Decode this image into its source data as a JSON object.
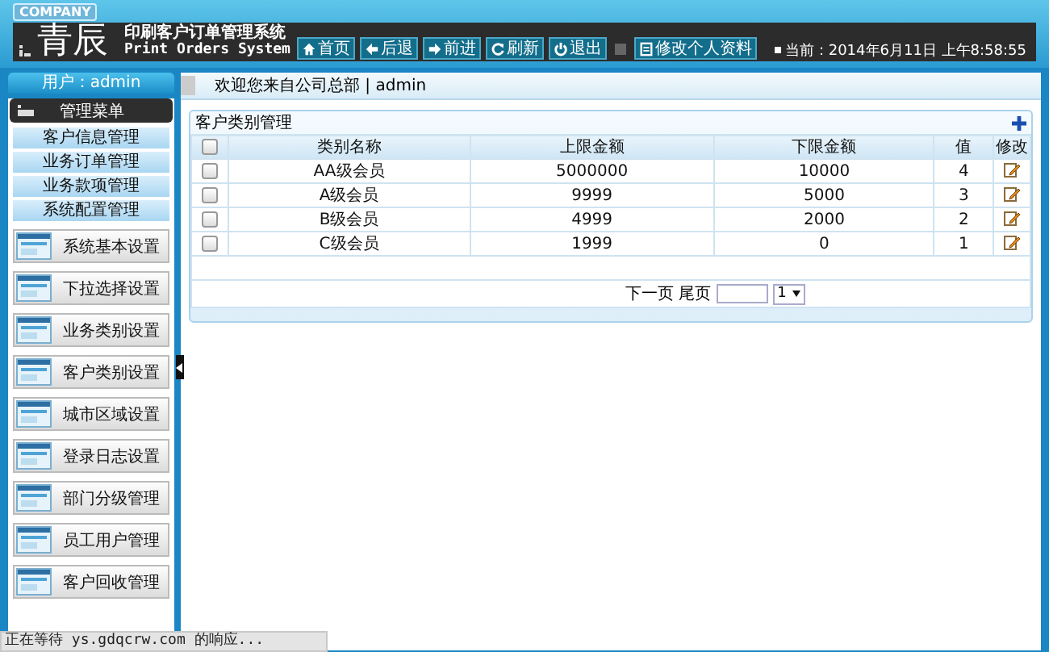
{
  "header": {
    "badge": "COMPANY",
    "logo": "青辰",
    "title": "印刷客户订单管理系统",
    "subtitle": "Print Orders System",
    "nav": [
      {
        "kind": "home",
        "label": "首页"
      },
      {
        "kind": "back",
        "label": "后退"
      },
      {
        "kind": "forward",
        "label": "前进"
      },
      {
        "kind": "refresh",
        "label": "刷新"
      },
      {
        "kind": "power",
        "label": "退出"
      },
      {
        "kind": "edit",
        "label": "修改个人资料"
      }
    ],
    "clock": "当前：2014年6月11日 上午8:58:55"
  },
  "sidebar": {
    "user": "用户：admin",
    "menu_title": "管理菜单",
    "sections": [
      "客户信息管理",
      "业务订单管理",
      "业务款项管理",
      "系统配置管理"
    ],
    "items": [
      "系统基本设置",
      "下拉选择设置",
      "业务类别设置",
      "客户类别设置",
      "城市区域设置",
      "登录日志设置",
      "部门分级管理",
      "员工用户管理",
      "客户回收管理"
    ]
  },
  "welcome": "欢迎您来自公司总部 | admin",
  "panel": {
    "title": "客户类别管理",
    "header_checked": false,
    "columns": [
      "类别名称",
      "上限金额",
      "下限金额",
      "值",
      "修改"
    ],
    "rows": [
      {
        "checked": false,
        "cells": [
          "AA级会员",
          "5000000",
          "10000",
          "4"
        ]
      },
      {
        "checked": false,
        "cells": [
          "A级会员",
          "9999",
          "5000",
          "3"
        ]
      },
      {
        "checked": false,
        "cells": [
          "B级会员",
          "4999",
          "2000",
          "2"
        ]
      },
      {
        "checked": false,
        "cells": [
          "C级会员",
          "1999",
          "0",
          "1"
        ]
      }
    ],
    "pagination": {
      "links": [
        "下一页",
        "尾页"
      ],
      "page_select": "1"
    }
  },
  "status_bar": "正在等待 ys.gdqcrw.com 的响应..."
}
